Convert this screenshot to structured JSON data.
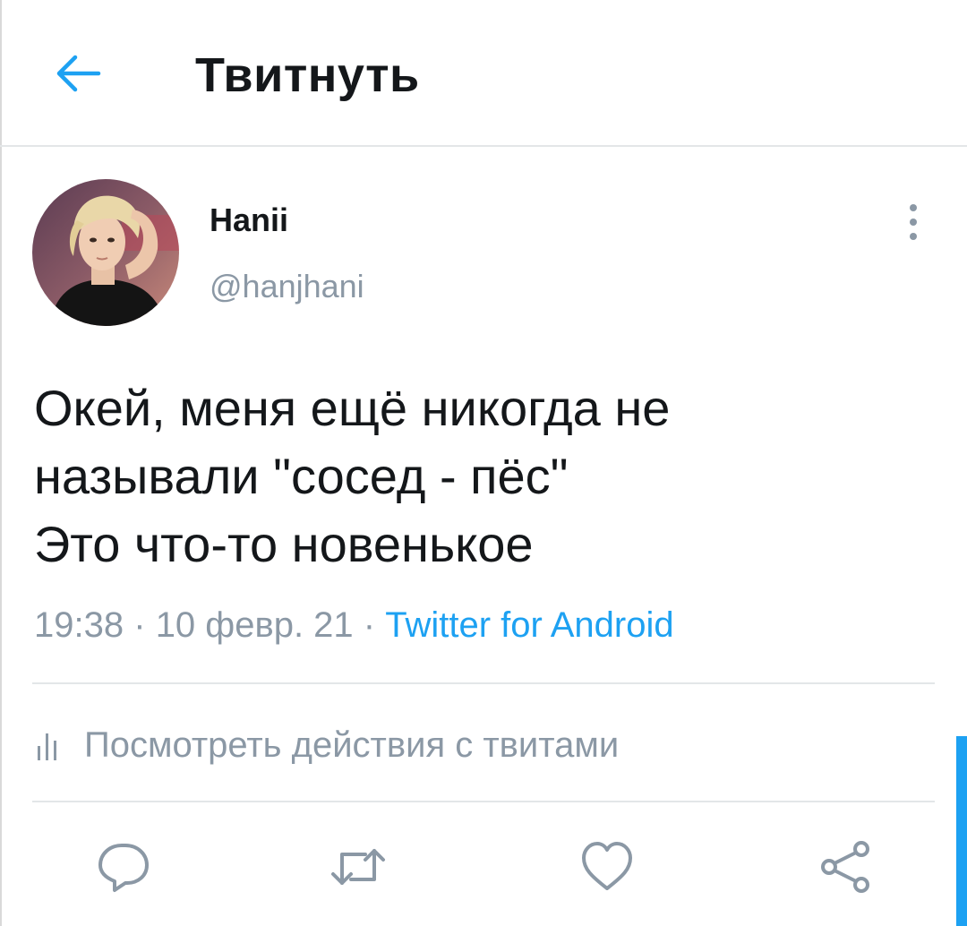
{
  "header": {
    "title": "Твитнуть",
    "back_icon": "arrow-left-icon"
  },
  "author": {
    "name": "Hanii",
    "handle": "@hanjhani",
    "avatar_icon": "avatar"
  },
  "tweet": {
    "text_lines": [
      "Окей, меня ещё никогда не",
      "называли \"сосед - пёс\"",
      "Это что-то новенькое"
    ],
    "time": "19:38",
    "separator": "·",
    "date": "10 февр. 21",
    "source": "Twitter for Android"
  },
  "activity": {
    "label": "Посмотреть действия с твитами",
    "icon": "analytics-bars-icon"
  },
  "actions": [
    {
      "icon": "reply-icon"
    },
    {
      "icon": "retweet-icon"
    },
    {
      "icon": "heart-icon"
    },
    {
      "icon": "share-icon"
    }
  ],
  "colors": {
    "accent": "#1da1f2",
    "text": "#14171a",
    "secondary": "#8b98a5",
    "divider": "#e3e6e8"
  }
}
